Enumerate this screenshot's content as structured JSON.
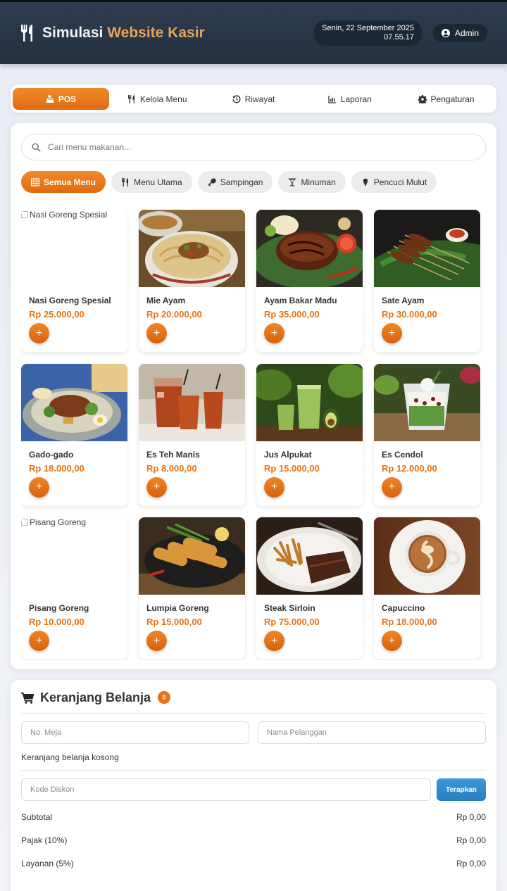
{
  "app": {
    "title_part1": "Simulasi ",
    "title_part2": "Website Kasir",
    "date": "Senin, 22 September 2025",
    "time": "07.55.17",
    "user": "Admin"
  },
  "colors": {
    "accent": "#e67317",
    "header": "#2a3646",
    "blue_button": "#2f86c8"
  },
  "nav": {
    "tabs": [
      {
        "label": "POS",
        "icon": "cash-register-icon",
        "active": true
      },
      {
        "label": "Kelola Menu",
        "icon": "utensils-icon"
      },
      {
        "label": "Riwayat",
        "icon": "history-icon"
      },
      {
        "label": "Laporan",
        "icon": "chart-icon"
      },
      {
        "label": "Pengaturan",
        "icon": "gear-icon"
      }
    ]
  },
  "search": {
    "placeholder": "Cari menu makanan..."
  },
  "categories": [
    {
      "label": "Semua Menu",
      "icon": "grid-icon",
      "active": true
    },
    {
      "label": "Menu Utama",
      "icon": "utensils-icon"
    },
    {
      "label": "Sampingan",
      "icon": "drumstick-icon"
    },
    {
      "label": "Minuman",
      "icon": "cocktail-icon"
    },
    {
      "label": "Pencuci Mulut",
      "icon": "ice-cream-icon"
    }
  ],
  "menu": [
    {
      "name": "Nasi Goreng Spesial",
      "price": "Rp 25.000,00",
      "image": "broken",
      "alt": "Nasi Goreng Spesial"
    },
    {
      "name": "Mie Ayam",
      "price": "Rp 20.000,00",
      "image": "noodles"
    },
    {
      "name": "Ayam Bakar Madu",
      "price": "Rp 35.000,00",
      "image": "grilled-chicken"
    },
    {
      "name": "Sate Ayam",
      "price": "Rp 30.000,00",
      "image": "satay"
    },
    {
      "name": "Gado-gado",
      "price": "Rp 18.000,00",
      "image": "gado-gado"
    },
    {
      "name": "Es Teh Manis",
      "price": "Rp 8.000,00",
      "image": "iced-tea"
    },
    {
      "name": "Jus Alpukat",
      "price": "Rp 15.000,00",
      "image": "avocado-juice"
    },
    {
      "name": "Es Cendol",
      "price": "Rp 12.000,00",
      "image": "cendol"
    },
    {
      "name": "Pisang Goreng",
      "price": "Rp 10.000,00",
      "image": "broken",
      "alt": "Pisang Goreng"
    },
    {
      "name": "Lumpia Goreng",
      "price": "Rp 15.000,00",
      "image": "spring-rolls"
    },
    {
      "name": "Steak Sirloin",
      "price": "Rp 75.000,00",
      "image": "steak"
    },
    {
      "name": "Capuccino",
      "price": "Rp 18.000,00",
      "image": "cappuccino"
    }
  ],
  "add_label": "+",
  "cart": {
    "title": "Keranjang Belanja",
    "count": "0",
    "table_placeholder": "No. Meja",
    "customer_placeholder": "Nama Pelanggan",
    "empty": "Keranjang belanja kosong",
    "discount_placeholder": "Kode Diskon",
    "apply": "Terapkan",
    "summary": [
      {
        "label": "Subtotal",
        "value": "Rp 0,00"
      },
      {
        "label": "Pajak (10%)",
        "value": "Rp 0,00"
      },
      {
        "label": "Layanan (5%)",
        "value": "Rp 0,00"
      }
    ]
  }
}
